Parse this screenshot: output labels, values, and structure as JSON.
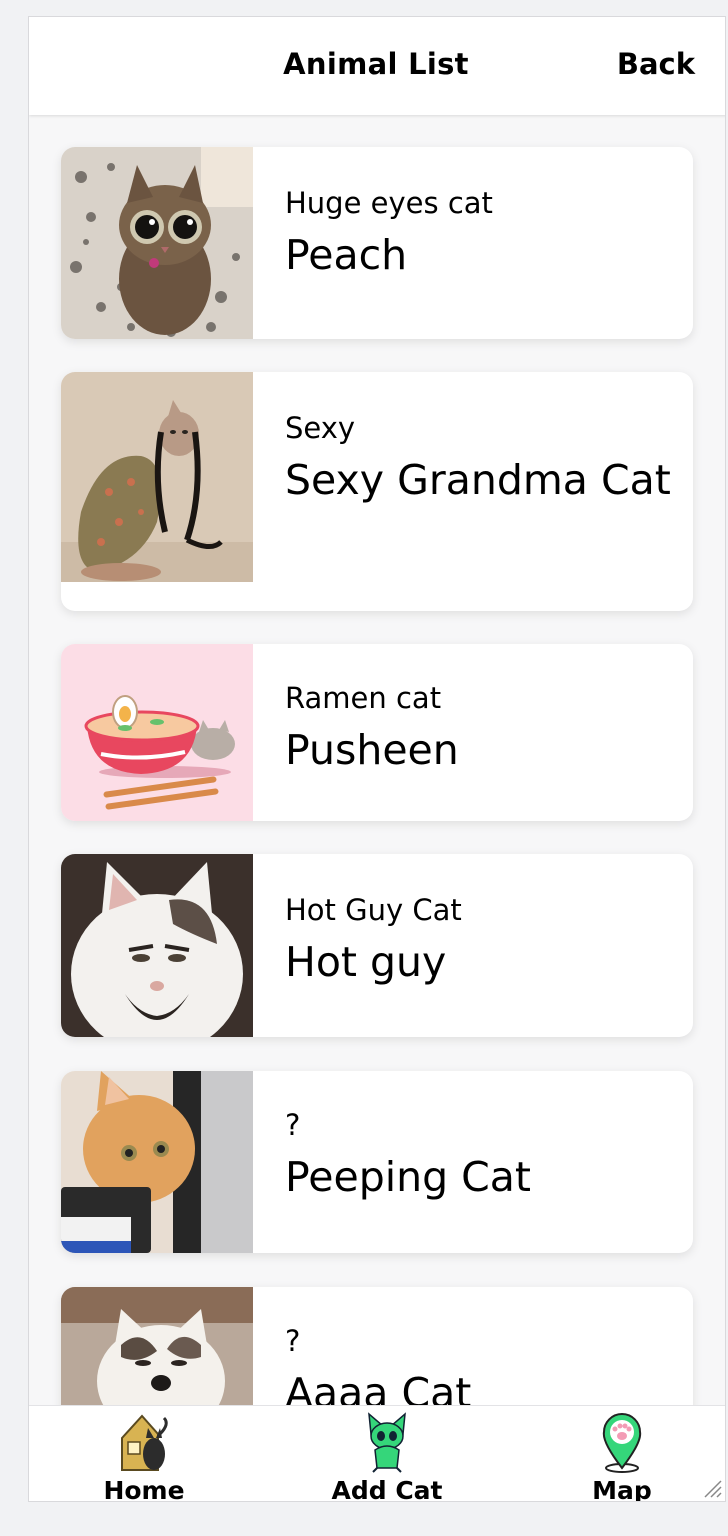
{
  "header": {
    "title": "Animal List",
    "back_label": "Back"
  },
  "cats": [
    {
      "subtitle": "Huge eyes cat",
      "name": "Peach",
      "thumb_icon": "tabby-cat-photo"
    },
    {
      "subtitle": "Sexy",
      "name": "Sexy Grandma Cat",
      "thumb_icon": "hairless-cat-photo"
    },
    {
      "subtitle": "Ramen cat",
      "name": "Pusheen",
      "thumb_icon": "ramen-bowl-illustration"
    },
    {
      "subtitle": "Hot Guy Cat",
      "name": "Hot guy",
      "thumb_icon": "white-cat-beard-photo"
    },
    {
      "subtitle": "?",
      "name": "Peeping Cat",
      "thumb_icon": "orange-cat-peeking-photo"
    },
    {
      "subtitle": "?",
      "name": "Aaaa Cat",
      "thumb_icon": "white-cat-open-mouth-photo"
    }
  ],
  "tabbar": {
    "home_label": "Home",
    "add_label": "Add Cat",
    "map_label": "Map"
  },
  "colors": {
    "accent_green": "#35d67a",
    "pin_pink": "#f39bb5",
    "tab_bg": "#ffffff"
  }
}
